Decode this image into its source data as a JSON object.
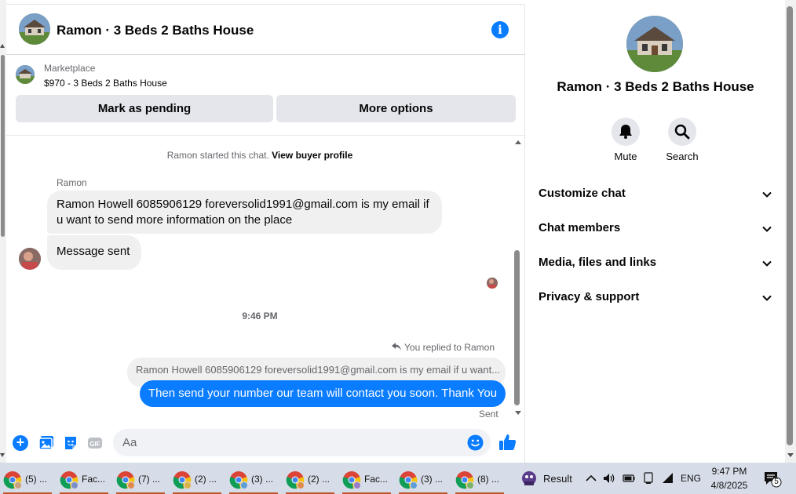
{
  "header": {
    "title": "Ramon · 3 Beds 2 Baths House"
  },
  "marketplace": {
    "label": "Marketplace",
    "item": "$970 - 3 Beds 2 Baths House",
    "mark_pending": "Mark as pending",
    "more_options": "More options"
  },
  "messages": {
    "started_text": "Ramon started this chat.",
    "view_profile": "View buyer profile",
    "sender": "Ramon",
    "incoming": [
      "Ramon Howell 6085906129 foreversolid1991@gmail.com is my email if u want to send more information on the place",
      "Message sent"
    ],
    "timestamp": "9:46 PM",
    "replied_to": "You replied to Ramon",
    "quoted": "Ramon Howell 6085906129 foreversolid1991@gmail.com is my email if u want...",
    "outgoing": "Then send your number our team will contact you soon. Thank You",
    "status": "Sent"
  },
  "composer": {
    "placeholder": "Aa",
    "value": ""
  },
  "info_panel": {
    "title": "Ramon · 3 Beds 2 Baths House",
    "actions": [
      {
        "label": "Mute",
        "icon": "bell-icon"
      },
      {
        "label": "Search",
        "icon": "search-icon"
      }
    ],
    "sections": [
      "Customize chat",
      "Chat members",
      "Media, files and links",
      "Privacy & support"
    ]
  },
  "taskbar": {
    "tabs": [
      {
        "label": "(5) ...",
        "icon": "chrome-profile-icon"
      },
      {
        "label": "Fac...",
        "icon": "chrome-profile-icon"
      },
      {
        "label": "(7) ...",
        "icon": "chrome-profile-icon"
      },
      {
        "label": "(2) ...",
        "icon": "chrome-profile-icon"
      },
      {
        "label": "(3) ...",
        "icon": "chrome-profile-icon"
      },
      {
        "label": "(2) ...",
        "icon": "chrome-profile-icon"
      },
      {
        "label": "Fac...",
        "icon": "chrome-profile-icon"
      },
      {
        "label": "(3) ...",
        "icon": "chrome-profile-icon"
      },
      {
        "label": "(8) ...",
        "icon": "chrome-profile-icon"
      }
    ],
    "result_label": "Result",
    "language": "ENG",
    "time": "9:47 PM",
    "date": "4/8/2025",
    "notification_count": "5"
  },
  "colors": {
    "messenger_blue": "#0a7cff",
    "bubble_gray": "#f0f0f0",
    "button_gray": "#e4e6eb",
    "taskbar": "#d7dde8"
  }
}
